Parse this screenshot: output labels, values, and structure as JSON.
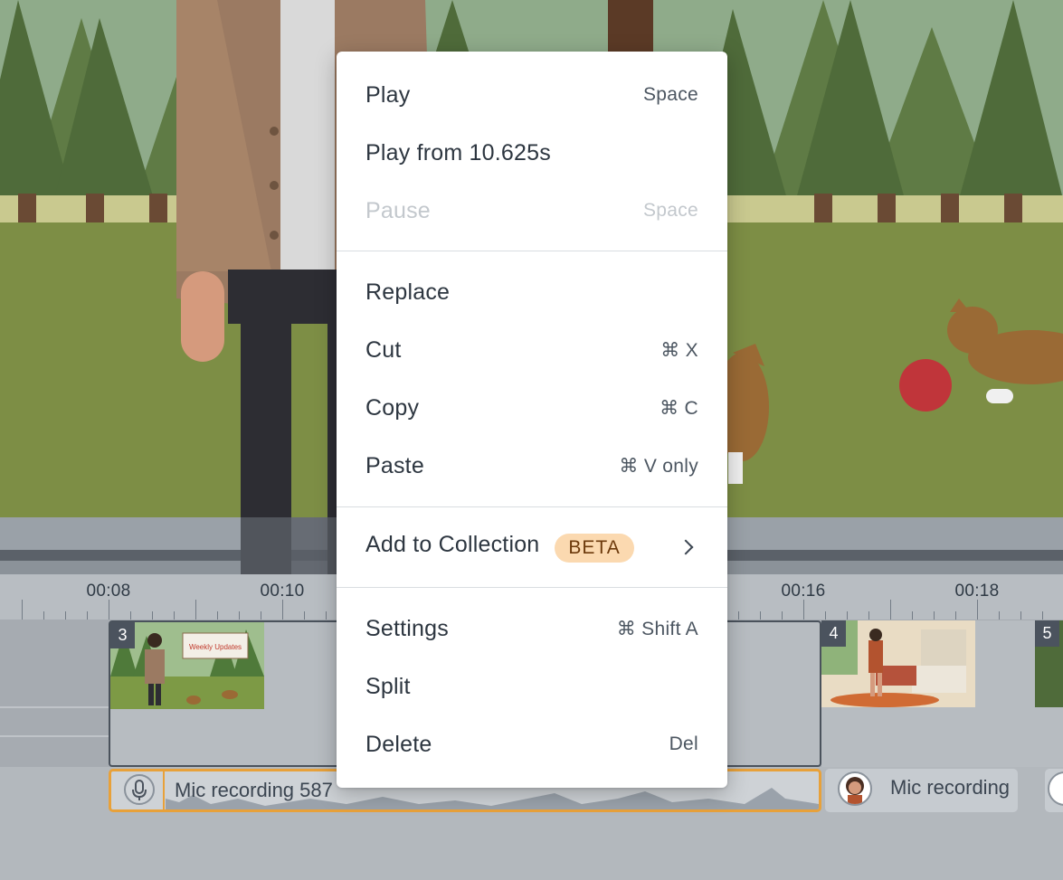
{
  "context_menu": {
    "items": [
      {
        "label": "Play",
        "shortcut": "Space",
        "disabled": false
      },
      {
        "label": "Play from 10.625s",
        "shortcut": "",
        "disabled": false
      },
      {
        "label": "Pause",
        "shortcut": "Space",
        "disabled": true
      },
      {
        "label": "Replace",
        "shortcut": "",
        "disabled": false
      },
      {
        "label": "Cut",
        "shortcut": "⌘ X",
        "disabled": false
      },
      {
        "label": "Copy",
        "shortcut": "⌘ C",
        "disabled": false
      },
      {
        "label": "Paste",
        "shortcut": "⌘ V only",
        "disabled": false
      },
      {
        "label": "Add to Collection",
        "badge": "BETA",
        "has_submenu": true
      },
      {
        "label": "Settings",
        "shortcut": "⌘ Shift A",
        "disabled": false
      },
      {
        "label": "Split",
        "shortcut": "",
        "disabled": false
      },
      {
        "label": "Delete",
        "shortcut": "Del",
        "disabled": false
      }
    ]
  },
  "timeline": {
    "ruler_labels": [
      "00:08",
      "00:10",
      "00:16",
      "00:18"
    ],
    "scenes": [
      {
        "number": "3",
        "thumb_text": "Weekly Updates"
      },
      {
        "number": "4"
      },
      {
        "number": "5"
      }
    ],
    "audio_clips": [
      {
        "label": "Mic recording 587"
      },
      {
        "label": "Mic recording"
      }
    ]
  },
  "colors": {
    "accent_selection": "#e8a13a",
    "beta_badge_bg": "#fbd9b0",
    "sky": "#8fab8a",
    "grass": "#7d8e45"
  }
}
